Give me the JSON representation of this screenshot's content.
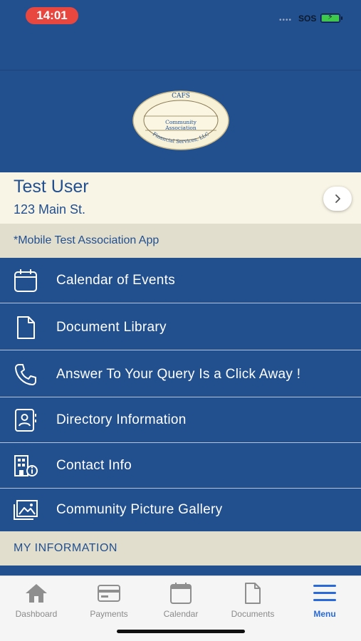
{
  "status_bar": {
    "time": "14:01",
    "carrier": "SOS"
  },
  "logo": {
    "top_text": "CAFS",
    "line1": "Community",
    "line2": "Association",
    "ring_text": "Financial Services, LLC"
  },
  "profile": {
    "name": "Test User",
    "address": "123 Main St."
  },
  "association_header": "*Mobile Test Association App",
  "menu_items": [
    {
      "label": "Calendar of Events",
      "icon": "calendar-icon"
    },
    {
      "label": "Document Library",
      "icon": "document-icon"
    },
    {
      "label": "Answer To Your Query Is a Click Away !",
      "icon": "phone-icon"
    },
    {
      "label": "Directory Information",
      "icon": "directory-icon"
    },
    {
      "label": "Contact Info",
      "icon": "building-info-icon"
    },
    {
      "label": "Community Picture Gallery",
      "icon": "gallery-icon"
    }
  ],
  "my_info_header": "MY INFORMATION",
  "tabs": [
    {
      "label": "Dashboard",
      "icon": "home-icon"
    },
    {
      "label": "Payments",
      "icon": "card-icon"
    },
    {
      "label": "Calendar",
      "icon": "calendar-icon"
    },
    {
      "label": "Documents",
      "icon": "document-icon"
    },
    {
      "label": "Menu",
      "icon": "menu-icon",
      "active": true
    }
  ],
  "colors": {
    "primary": "#22508f",
    "card": "#f9f5e6",
    "section": "#e2dece",
    "active_tab": "#2a6ad8"
  }
}
